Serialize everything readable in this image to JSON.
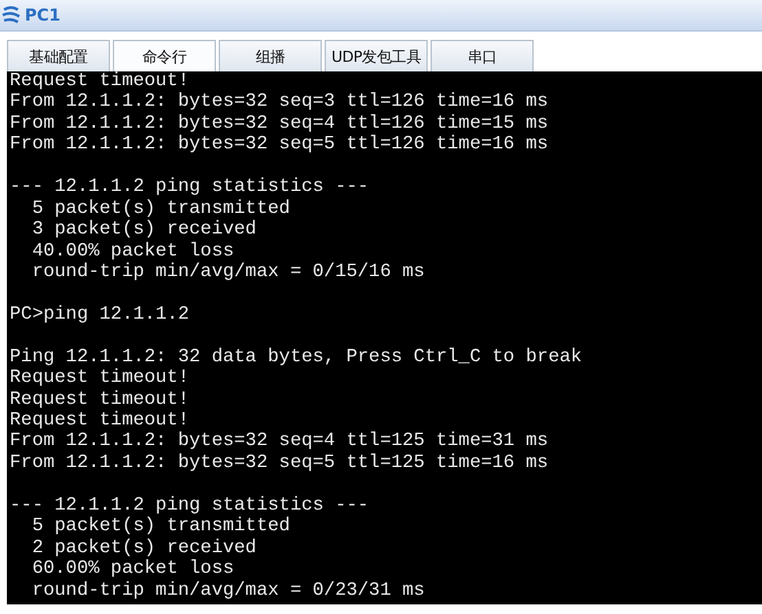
{
  "window": {
    "title": "PC1"
  },
  "tabs": [
    {
      "label": "基础配置",
      "selected": false
    },
    {
      "label": "命令行",
      "selected": true
    },
    {
      "label": "组播",
      "selected": false
    },
    {
      "label": "UDP发包工具",
      "selected": false
    },
    {
      "label": "串口",
      "selected": false
    }
  ],
  "terminal": {
    "blocks": [
      {
        "lines": [
          "Request timeout!",
          "From 12.1.1.2: bytes=32 seq=3 ttl=126 time=16 ms",
          "From 12.1.1.2: bytes=32 seq=4 ttl=126 time=15 ms",
          "From 12.1.1.2: bytes=32 seq=5 ttl=126 time=16 ms"
        ]
      },
      {
        "lines": [
          "--- 12.1.1.2 ping statistics ---",
          "  5 packet(s) transmitted",
          "  3 packet(s) received",
          "  40.00% packet loss",
          "  round-trip min/avg/max = 0/15/16 ms"
        ]
      },
      {
        "lines": [
          "PC>ping 12.1.1.2"
        ]
      },
      {
        "lines": [
          "Ping 12.1.1.2: 32 data bytes, Press Ctrl_C to break",
          "Request timeout!",
          "Request timeout!",
          "Request timeout!",
          "From 12.1.1.2: bytes=32 seq=4 ttl=125 time=31 ms",
          "From 12.1.1.2: bytes=32 seq=5 ttl=125 time=16 ms"
        ]
      },
      {
        "lines": [
          "--- 12.1.1.2 ping statistics ---",
          "  5 packet(s) transmitted",
          "  2 packet(s) received",
          "  60.00% packet loss",
          "  round-trip min/avg/max = 0/23/31 ms"
        ]
      }
    ]
  }
}
